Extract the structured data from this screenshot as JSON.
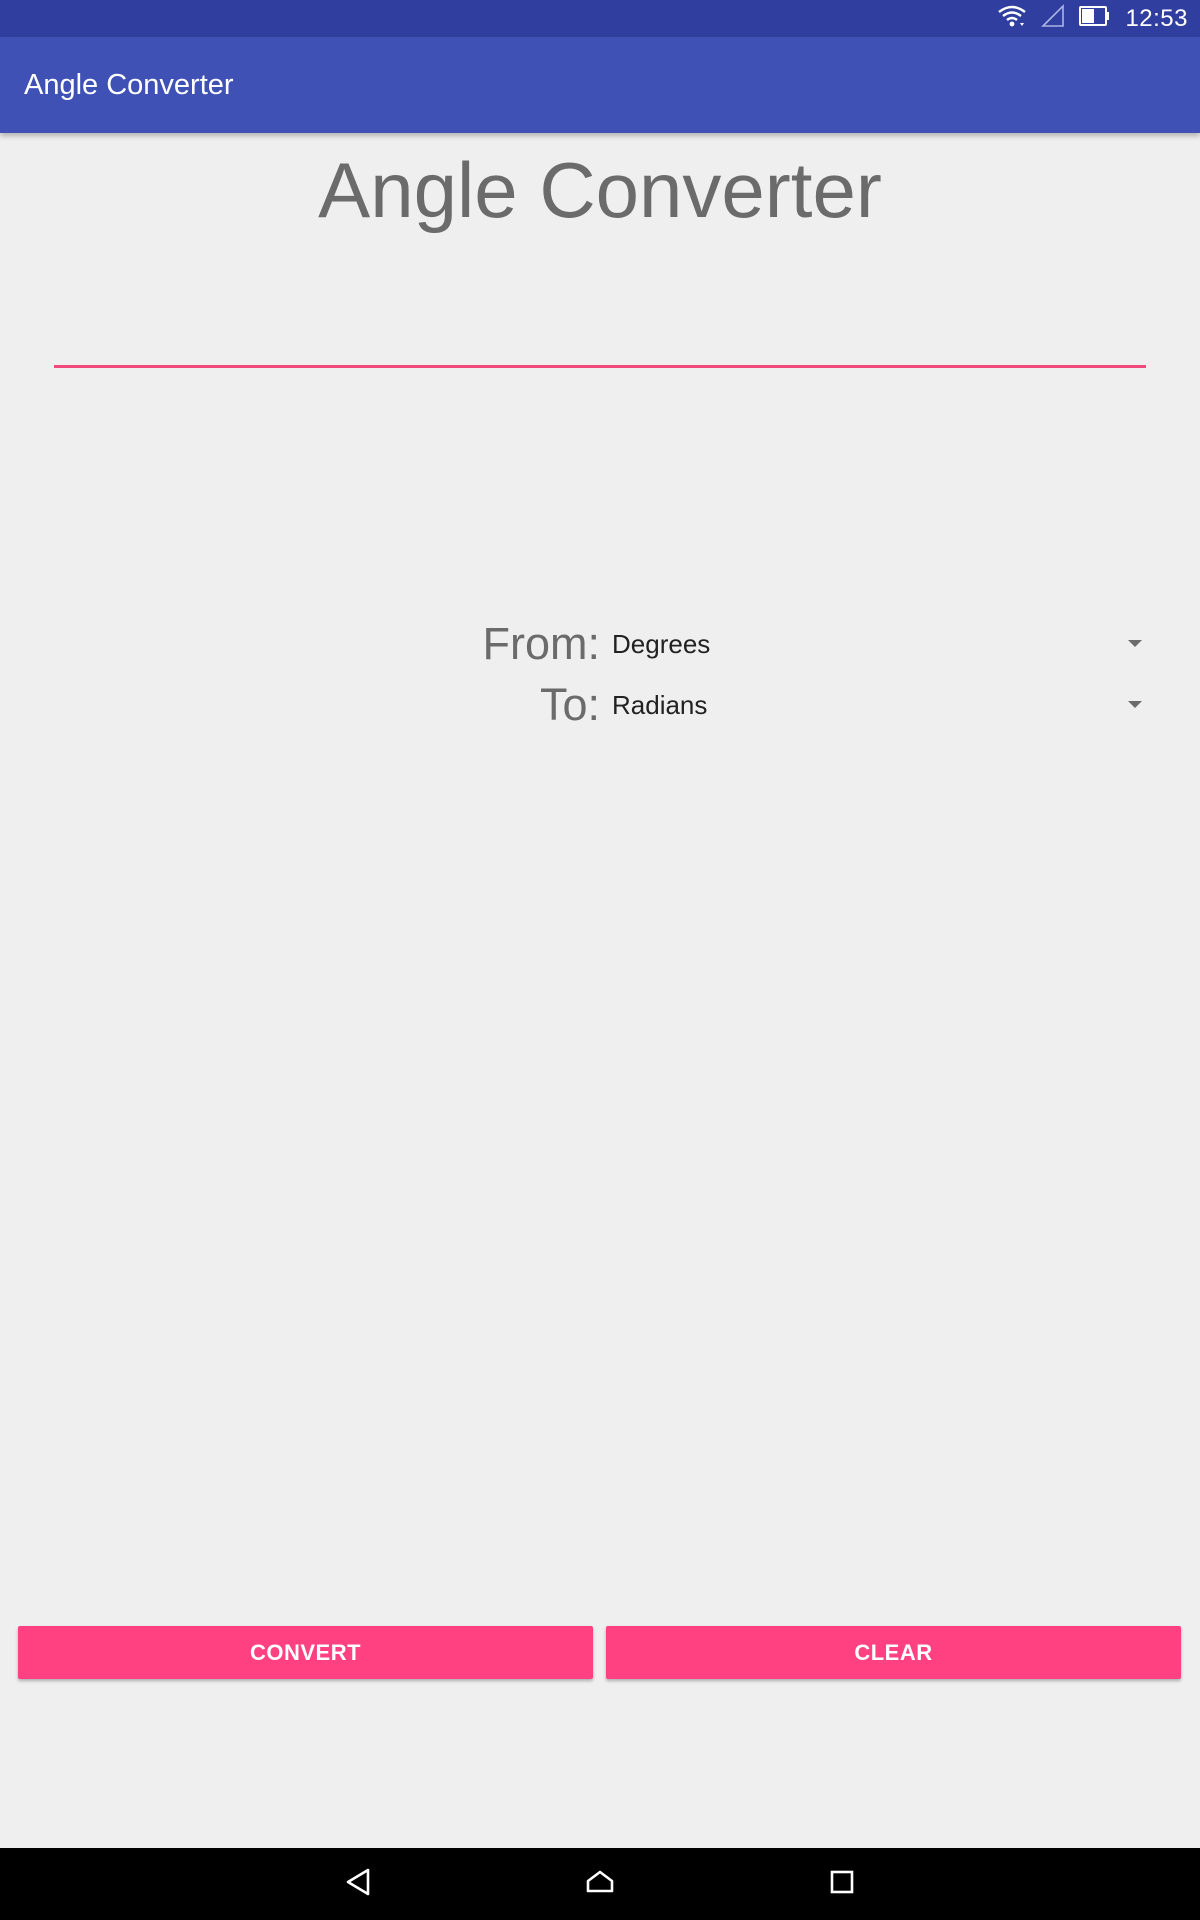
{
  "status_bar": {
    "time": "12:53",
    "icons": [
      "wifi-icon",
      "cellular-signal-icon",
      "battery-icon"
    ]
  },
  "app_bar": {
    "title": "Angle Converter"
  },
  "main": {
    "heading": "Angle Converter",
    "input": {
      "value": "",
      "placeholder": ""
    },
    "from": {
      "label": "From:",
      "selected": "Degrees"
    },
    "to": {
      "label": "To:",
      "selected": "Radians"
    },
    "buttons": {
      "convert": "CONVERT",
      "clear": "CLEAR"
    }
  },
  "nav_bar": {
    "icons": [
      "back-icon",
      "home-icon",
      "recents-icon"
    ]
  },
  "colors": {
    "status_bar": "#303f9f",
    "app_bar": "#3f51b5",
    "accent": "#ff4081",
    "input_underline": "#ef4a7b",
    "background": "#efefef"
  }
}
